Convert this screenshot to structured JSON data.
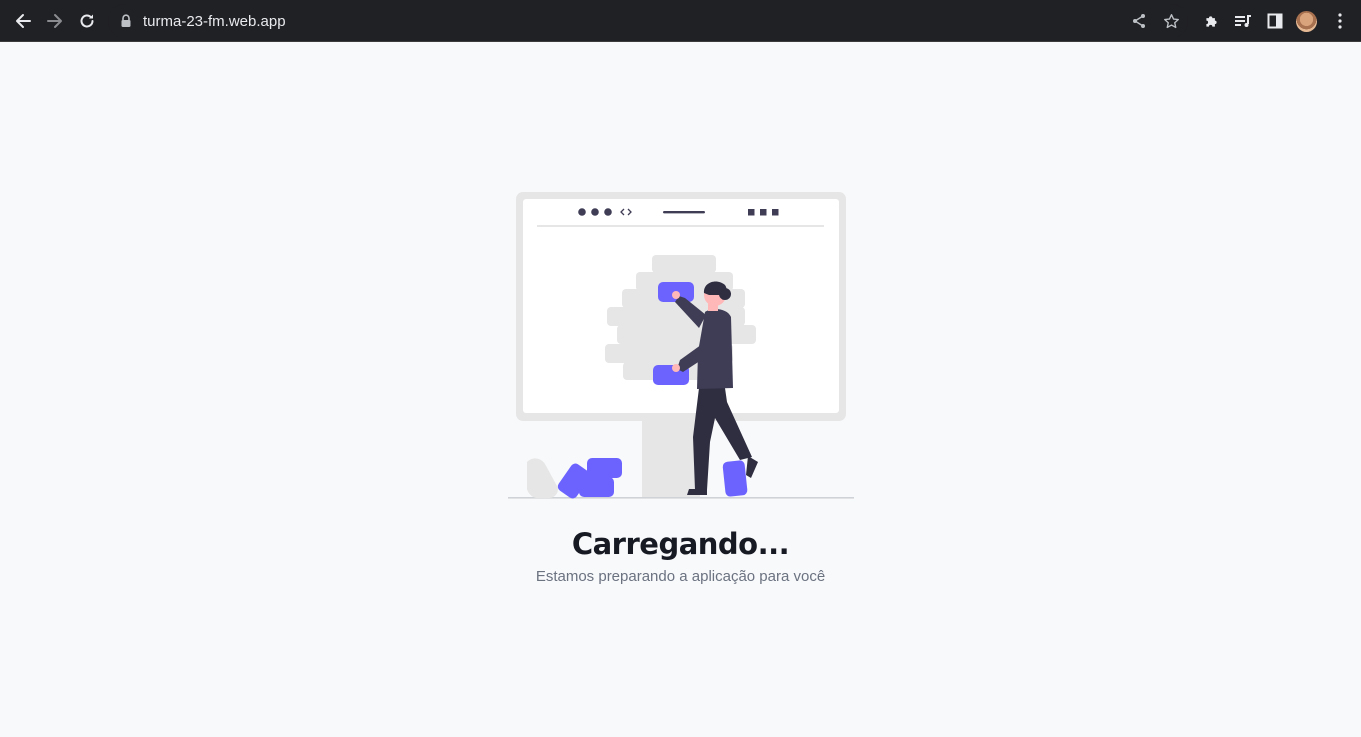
{
  "browser": {
    "url": "turma-23-fm.web.app",
    "icons": {
      "back": "arrow-left-icon",
      "forward": "arrow-right-icon",
      "reload": "reload-icon",
      "lock": "lock-icon",
      "share": "share-icon",
      "bookmark": "star-icon",
      "extensions": "puzzle-icon",
      "media": "media-queue-icon",
      "side_panel": "side-panel-icon",
      "menu": "kebab-menu-icon"
    }
  },
  "loading": {
    "title": "Carregando...",
    "subtitle": "Estamos preparando a aplicação para você"
  },
  "colors": {
    "accent": "#6c63ff",
    "dark": "#2f2e41",
    "light_gray": "#e6e6e6",
    "background": "#f8f9fb",
    "toolbar": "#202124"
  }
}
